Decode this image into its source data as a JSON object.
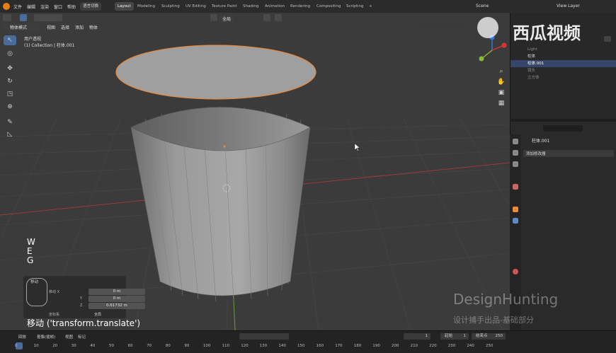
{
  "topbar": {
    "menus": [
      "文件",
      "编辑",
      "渲染",
      "窗口",
      "帮助"
    ],
    "highlight_label": "语言切换",
    "workspaces": [
      "Layout",
      "Modeling",
      "Sculpting",
      "UV Editing",
      "Texture Paint",
      "Shading",
      "Animation",
      "Rendering",
      "Compositing",
      "Scripting"
    ],
    "add_tab": "+",
    "scene_label": "Scene",
    "view_layer_label": "View Layer"
  },
  "viewport_header": {
    "mode_label": "物体模式",
    "menus": [
      "视图",
      "选择",
      "添加",
      "物体"
    ],
    "orientation_label": "全局"
  },
  "viewport_info": {
    "line1": "用户透视",
    "line2": "(1) Collection | 柱体.001"
  },
  "keys_display": [
    "W",
    "E",
    "G"
  ],
  "operator": {
    "title_label": "移动",
    "x_label": "移动 X",
    "x_value": "0 m",
    "y_label": "Y",
    "y_value": "0 m",
    "z_label": "Z",
    "z_value": "0.61732 m",
    "orient_label": "坐标系",
    "orient_value": "全局",
    "caption": "移动 ('transform.translate')"
  },
  "outliner": {
    "items": [
      {
        "label": "Light",
        "selected": false
      },
      {
        "label": "柱体",
        "selected": false
      },
      {
        "label": "柱体.001",
        "selected": true
      },
      {
        "label": "镜头",
        "selected": false
      },
      {
        "label": "立方体",
        "selected": false
      }
    ]
  },
  "properties": {
    "object_name": "柱体.001",
    "add_modifier_label": "添加修改器"
  },
  "timeline": {
    "menus": [
      "回放",
      "抠像(插帧)",
      "视图",
      "标记"
    ],
    "current_frame": "1",
    "start_label": "起始",
    "start_value": "1",
    "end_label": "结束点",
    "end_value": "250",
    "ticks": [
      "0",
      "10",
      "20",
      "30",
      "40",
      "50",
      "60",
      "70",
      "80",
      "90",
      "100",
      "110",
      "120",
      "130",
      "140",
      "150",
      "160",
      "170",
      "180",
      "190",
      "200",
      "210",
      "220",
      "230",
      "240",
      "250"
    ]
  },
  "watermark": {
    "brand": "西瓜视频",
    "design_line1": "DesignHunting",
    "design_line2": "设计捕手出品-基础部分"
  },
  "colors": {
    "selection_outline": "#e8883a",
    "active_tool": "#4a6c9b",
    "grid_x_axis": "#9b3a3a",
    "grid_y_axis": "#6a9b3a"
  }
}
